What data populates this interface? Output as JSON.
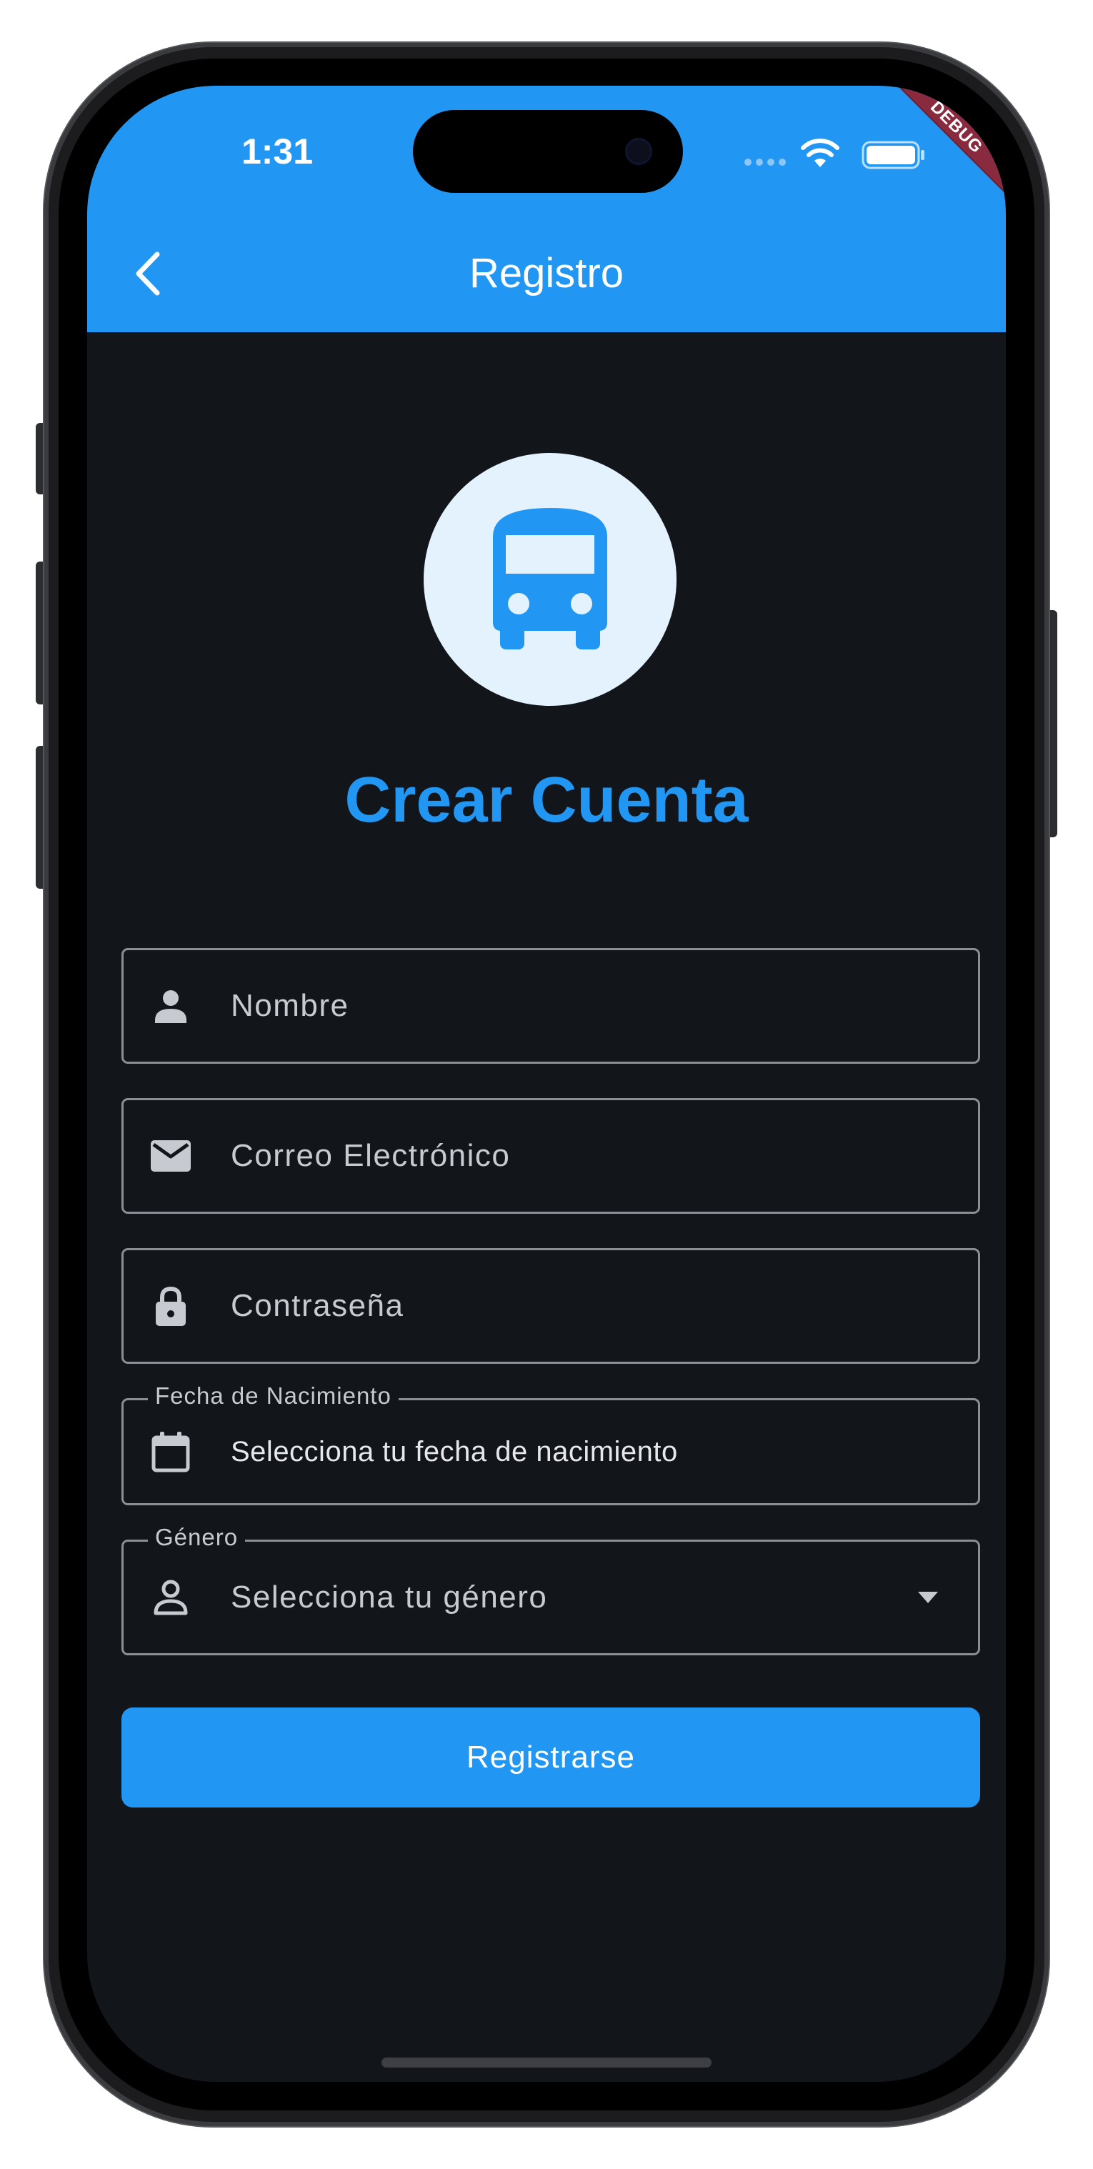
{
  "status_bar": {
    "time": "1:31",
    "icons": [
      "signal-dots-icon",
      "wifi-icon",
      "battery-icon"
    ]
  },
  "debug_banner": "DEBUG",
  "app_bar": {
    "title": "Registro",
    "back_icon": "chevron-left-icon",
    "background_color": "#2196f3"
  },
  "logo": {
    "icon": "bus-icon",
    "circle_color": "#e3f2fd",
    "icon_color": "#2196f3"
  },
  "heading": "Crear Cuenta",
  "form": {
    "name": {
      "placeholder": "Nombre",
      "icon": "person-icon"
    },
    "email": {
      "placeholder": "Correo Electrónico",
      "icon": "mail-icon"
    },
    "password": {
      "placeholder": "Contraseña",
      "icon": "lock-icon"
    },
    "birthdate": {
      "label": "Fecha de Nacimiento",
      "value": "Selecciona tu fecha de nacimiento",
      "icon": "calendar-icon"
    },
    "gender": {
      "label": "Género",
      "placeholder": "Selecciona tu género",
      "icon": "person-outline-icon",
      "dropdown_icon": "arrow-drop-down-icon"
    }
  },
  "submit_label": "Registrarse",
  "colors": {
    "primary": "#2196f3",
    "background": "#12151a",
    "field_border": "#8b8e94"
  }
}
